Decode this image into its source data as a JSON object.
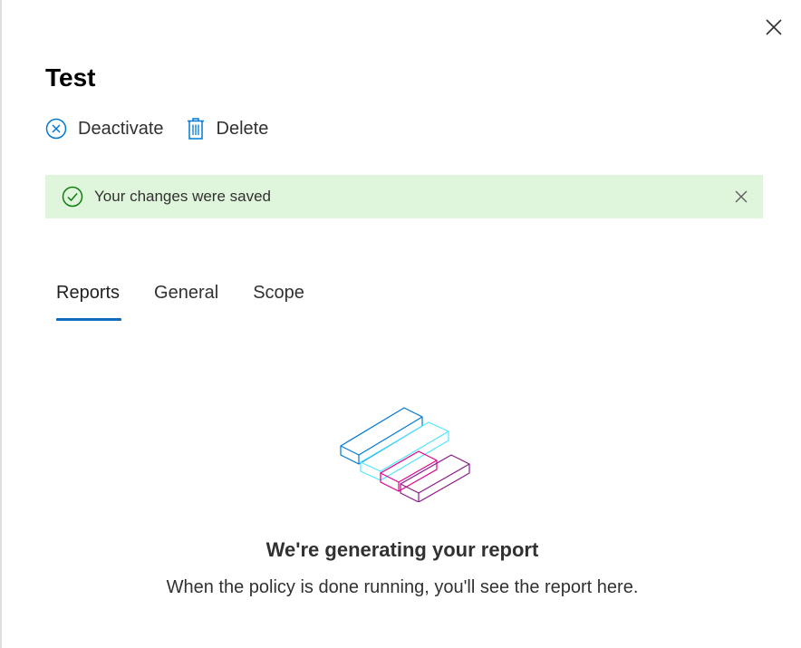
{
  "panel": {
    "title": "Test",
    "close_icon": "close-icon"
  },
  "commands": [
    {
      "label": "Deactivate",
      "icon": "deactivate-circle-x-icon"
    },
    {
      "label": "Delete",
      "icon": "trash-icon"
    }
  ],
  "message_bar": {
    "text": "Your changes were saved",
    "icon": "checkmark-circle-icon",
    "dismiss_icon": "dismiss-icon",
    "status": "success",
    "background": "#dff6dd",
    "icon_color": "#107c10"
  },
  "tabs": [
    {
      "label": "Reports",
      "active": true
    },
    {
      "label": "General",
      "active": false
    },
    {
      "label": "Scope",
      "active": false
    }
  ],
  "empty_state": {
    "illustration": "report-bars-illustration",
    "title": "We're generating your report",
    "subtitle": "When the policy is done running, you'll see the report here."
  },
  "colors": {
    "accent": "#0f6cbd",
    "bar_blue": "#0078d4",
    "bar_cyan": "#50e6ff",
    "bar_magenta": "#e3008c",
    "bar_purple": "#8b1b8b"
  }
}
